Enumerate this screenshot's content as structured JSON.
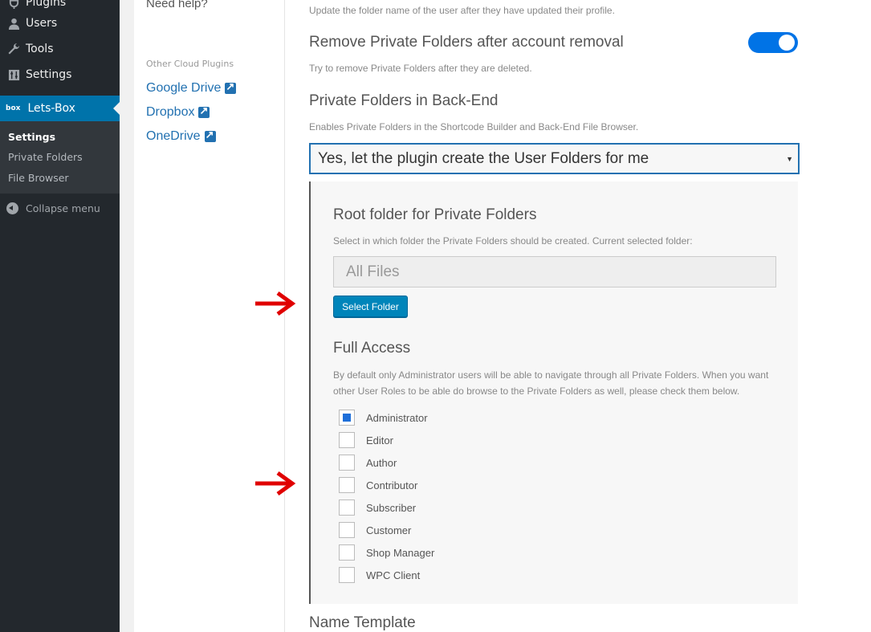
{
  "admin_menu": {
    "items": [
      {
        "label": "Plugins",
        "icon": "plugin-icon"
      },
      {
        "label": "Users",
        "icon": "users-icon"
      },
      {
        "label": "Tools",
        "icon": "wrench-icon"
      },
      {
        "label": "Settings",
        "icon": "settings-icon"
      },
      {
        "label": "Lets-Box",
        "icon": "box-logo-icon",
        "icon_text": "box"
      }
    ],
    "submenu": [
      "Settings",
      "Private Folders",
      "File Browser"
    ],
    "collapse_label": "Collapse menu"
  },
  "side_column": {
    "need_help": "Need help?",
    "other_plugins_label": "Other Cloud Plugins",
    "links": [
      "Google Drive",
      "Dropbox",
      "OneDrive"
    ]
  },
  "settings": {
    "update_folder_desc": "Update the folder name of the user after they have updated their profile.",
    "remove_title": "Remove Private Folders after account removal",
    "remove_toggle_on": true,
    "remove_desc": "Try to remove Private Folders after they are deleted.",
    "backend_title": "Private Folders in Back-End",
    "backend_desc": "Enables Private Folders in the Shortcode Builder and Back-End File Browser.",
    "backend_selected": "Yes, let the plugin create the User Folders for me",
    "root_title": "Root folder for Private Folders",
    "root_desc": "Select in which folder the Private Folders should be created. Current selected folder:",
    "root_value": "All Files",
    "select_folder_button": "Select Folder",
    "full_access_title": "Full Access",
    "full_access_desc": "By default only Administrator users will be able to navigate through all Private Folders. When you want other User Roles to be able do browse to the Private Folders as well, please check them below.",
    "roles": [
      {
        "label": "Administrator",
        "checked": true
      },
      {
        "label": "Editor",
        "checked": false
      },
      {
        "label": "Author",
        "checked": false
      },
      {
        "label": "Contributor",
        "checked": false
      },
      {
        "label": "Subscriber",
        "checked": false
      },
      {
        "label": "Customer",
        "checked": false
      },
      {
        "label": "Shop Manager",
        "checked": false
      },
      {
        "label": "WPC Client",
        "checked": false
      }
    ],
    "name_template_title": "Name Template"
  },
  "colors": {
    "admin_bg": "#23282d",
    "accent": "#0073aa",
    "toggle": "#0073e6",
    "arrow": "#e00000"
  }
}
